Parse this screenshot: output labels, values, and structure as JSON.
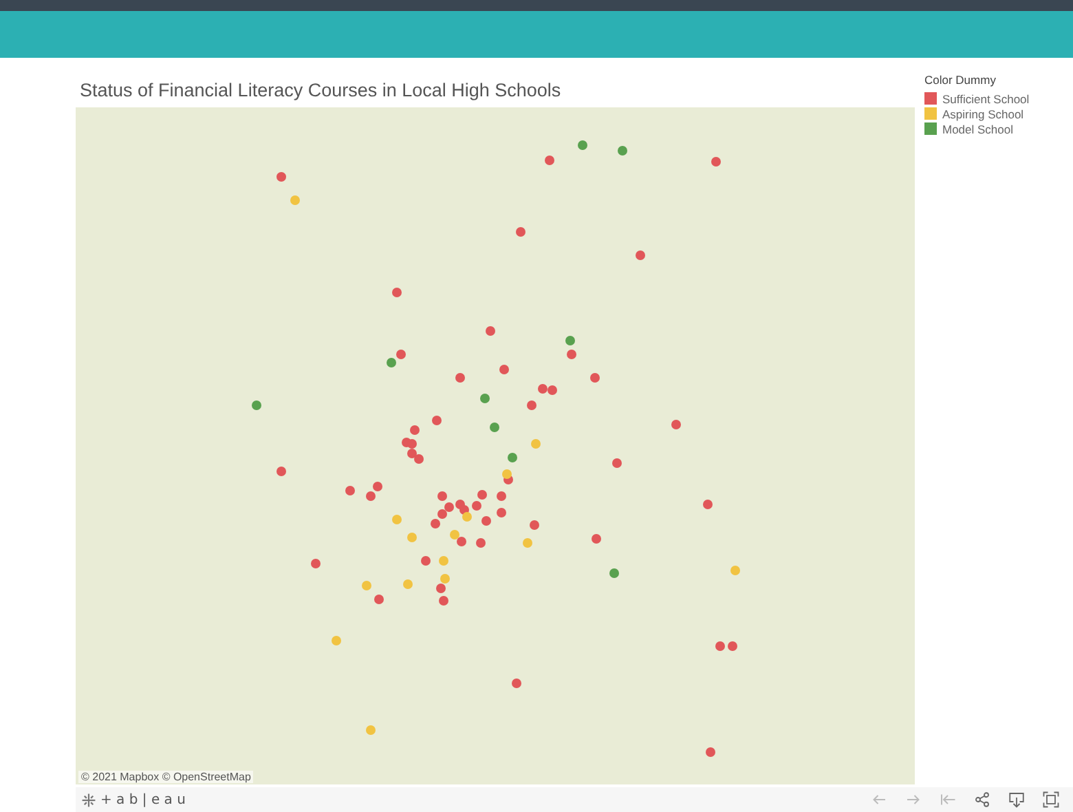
{
  "title": "Status of Financial Literacy Courses in Local High Schools",
  "legend": {
    "title": "Color Dummy",
    "items": [
      {
        "label": "Sufficient School",
        "color": "#e15759"
      },
      {
        "label": "Aspiring School",
        "color": "#f1c342"
      },
      {
        "label": "Model School",
        "color": "#59a14f"
      }
    ]
  },
  "map": {
    "attribution": "© 2021 Mapbox © OpenStreetMap",
    "points": [
      {
        "color": "#e15759"
      },
      {
        "color": "#f1c342"
      },
      {
        "color": "#e15759"
      },
      {
        "color": "#59a14f"
      },
      {
        "color": "#59a14f"
      },
      {
        "color": "#e15759"
      },
      {
        "color": "#e15759"
      },
      {
        "color": "#e15759"
      },
      {
        "color": "#e15759"
      },
      {
        "color": "#e15759"
      },
      {
        "color": "#59a14f"
      },
      {
        "color": "#e15759"
      },
      {
        "color": "#e15759"
      },
      {
        "color": "#59a14f"
      },
      {
        "color": "#e15759"
      },
      {
        "color": "#e15759"
      },
      {
        "color": "#e15759"
      },
      {
        "color": "#e15759"
      },
      {
        "color": "#e15759"
      },
      {
        "color": "#59a14f"
      },
      {
        "color": "#e15759"
      },
      {
        "color": "#59a14f"
      },
      {
        "color": "#e15759"
      },
      {
        "color": "#e15759"
      },
      {
        "color": "#59a14f"
      },
      {
        "color": "#e15759"
      },
      {
        "color": "#f1c342"
      },
      {
        "color": "#e15759"
      },
      {
        "color": "#e15759"
      },
      {
        "color": "#e15759"
      },
      {
        "color": "#e15759"
      },
      {
        "color": "#59a14f"
      },
      {
        "color": "#e15759"
      },
      {
        "color": "#e15759"
      },
      {
        "color": "#e15759"
      },
      {
        "color": "#f1c342"
      },
      {
        "color": "#e15759"
      },
      {
        "color": "#e15759"
      },
      {
        "color": "#e15759"
      },
      {
        "color": "#e15759"
      },
      {
        "color": "#e15759"
      },
      {
        "color": "#e15759"
      },
      {
        "color": "#e15759"
      },
      {
        "color": "#e15759"
      },
      {
        "color": "#e15759"
      },
      {
        "color": "#e15759"
      },
      {
        "color": "#e15759"
      },
      {
        "color": "#f1c342"
      },
      {
        "color": "#e15759"
      },
      {
        "color": "#f1c342"
      },
      {
        "color": "#e15759"
      },
      {
        "color": "#e15759"
      },
      {
        "color": "#e15759"
      },
      {
        "color": "#e15759"
      },
      {
        "color": "#f1c342"
      },
      {
        "color": "#f1c342"
      },
      {
        "color": "#e15759"
      },
      {
        "color": "#e15759"
      },
      {
        "color": "#f1c342"
      },
      {
        "color": "#e15759"
      },
      {
        "color": "#e15759"
      },
      {
        "color": "#e15759"
      },
      {
        "color": "#f1c342"
      },
      {
        "color": "#59a14f"
      },
      {
        "color": "#f1c342"
      },
      {
        "color": "#f1c342"
      },
      {
        "color": "#e15759"
      },
      {
        "color": "#f1c342"
      },
      {
        "color": "#f1c342"
      },
      {
        "color": "#e15759"
      },
      {
        "color": "#e15759"
      },
      {
        "color": "#f1c342"
      },
      {
        "color": "#e15759"
      },
      {
        "color": "#e15759"
      },
      {
        "color": "#e15759"
      },
      {
        "color": "#f1c342"
      },
      {
        "color": "#e15759"
      }
    ]
  },
  "footer": {
    "brand": "+ a b | e a u"
  }
}
